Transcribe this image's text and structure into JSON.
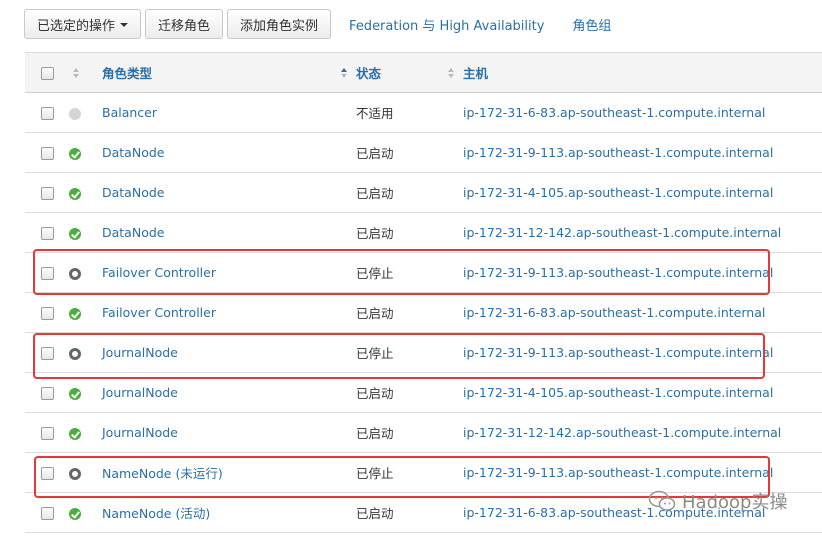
{
  "toolbar": {
    "selected_actions": "已选定的操作",
    "migrate_role": "迁移角色",
    "add_role_instance": "添加角色实例",
    "federation": "Federation 与 High Availability",
    "role_groups": "角色组"
  },
  "table": {
    "headers": {
      "type": "角色类型",
      "state": "状态",
      "host": "主机"
    },
    "rows": [
      {
        "status": "na",
        "type": "Balancer",
        "state": "不适用",
        "host": "ip-172-31-6-83.ap-southeast-1.compute.internal"
      },
      {
        "status": "good",
        "type": "DataNode",
        "state": "已启动",
        "host": "ip-172-31-9-113.ap-southeast-1.compute.internal"
      },
      {
        "status": "good",
        "type": "DataNode",
        "state": "已启动",
        "host": "ip-172-31-4-105.ap-southeast-1.compute.internal"
      },
      {
        "status": "good",
        "type": "DataNode",
        "state": "已启动",
        "host": "ip-172-31-12-142.ap-southeast-1.compute.internal"
      },
      {
        "status": "stopped",
        "type": "Failover Controller",
        "state": "已停止",
        "host": "ip-172-31-9-113.ap-southeast-1.compute.internal"
      },
      {
        "status": "good",
        "type": "Failover Controller",
        "state": "已启动",
        "host": "ip-172-31-6-83.ap-southeast-1.compute.internal"
      },
      {
        "status": "stopped",
        "type": "JournalNode",
        "state": "已停止",
        "host": "ip-172-31-9-113.ap-southeast-1.compute.internal"
      },
      {
        "status": "good",
        "type": "JournalNode",
        "state": "已启动",
        "host": "ip-172-31-4-105.ap-southeast-1.compute.internal"
      },
      {
        "status": "good",
        "type": "JournalNode",
        "state": "已启动",
        "host": "ip-172-31-12-142.ap-southeast-1.compute.internal"
      },
      {
        "status": "stopped",
        "type": "NameNode (未运行)",
        "state": "已停止",
        "host": "ip-172-31-9-113.ap-southeast-1.compute.internal"
      },
      {
        "status": "good",
        "type": "NameNode (活动)",
        "state": "已启动",
        "host": "ip-172-31-6-83.ap-southeast-1.compute.internal"
      }
    ]
  },
  "highlighted_rows": [
    4,
    6,
    9
  ],
  "watermark": {
    "text": "Hadoop实操",
    "icon": "wechat-icon"
  },
  "colors": {
    "link": "#2a6fa8",
    "good": "#4cae3f",
    "stopped": "#666666",
    "highlight": "#e53935"
  }
}
